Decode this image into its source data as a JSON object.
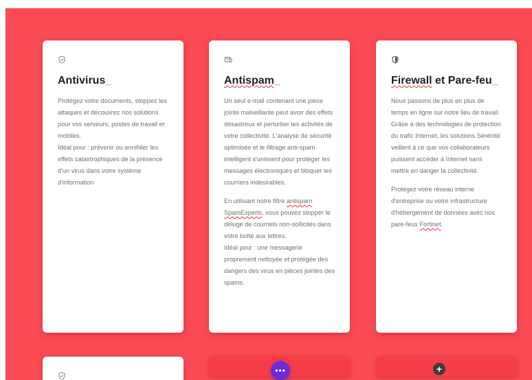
{
  "cards": [
    {
      "icon": "shield-check-icon",
      "title": "Antivirus",
      "accent": "_",
      "paragraphs": [
        "Protégez votre documents, stoppez les attaques et découvrez nos solutions pour vos serveurs, postes de travail et mobiles.",
        "Idéal pour : prévenir ou annihiler les effets catastrophiques de la présence d'un virus dans votre système d'information"
      ]
    },
    {
      "icon": "mail-filter-icon",
      "title": "Antispam",
      "accent": "_",
      "paragraphs": [
        "Un seul e-mail contenant une pièce jointe malveillante peut avoir des effets désastreux et perturber les activités de votre collectivité. L'analyse de sécurité optimisée et le filtrage anti-spam intelligent s'unissent pour protéger les messages électroniques et bloquer les courriers indésirables.",
        "En utilisant notre filtre",
        "antispam",
        "SpamExperts",
        ", vous pouvez stopper le déluge de courriels non-sollicités dans votre boîte aux lettres.",
        "Idéal pour : une messagerie proprement nettoyée et protégée des dangers des virus en pièces jointes des spams."
      ]
    },
    {
      "icon": "shield-icon",
      "title_before": "Firewall",
      "title_after": " et Pare-feu",
      "accent": "_",
      "paragraphs": [
        "Nous passons de plus en plus de temps en ligne sur notre lieu de travail. Grâce à des technologies de protection du trafic Internet, les solutions Sérénité veillent à ce que vos collaborateurs puissent accéder à Internet sans mettre en danger la collectivité.",
        "Protégez votre réseau interne d'entreprise ou votre infrastructure d'hébergement de données avec nos pare-feux",
        "Fortinet",
        "."
      ]
    },
    {
      "icon": "shield-check-icon"
    }
  ],
  "controls": {
    "more_label": "•••",
    "add_label": "+"
  },
  "colors": {
    "background": "#fa4b55",
    "accent": "#fa4b55",
    "more_button": "#6b2bd9",
    "add_button": "#3d3d3d"
  }
}
